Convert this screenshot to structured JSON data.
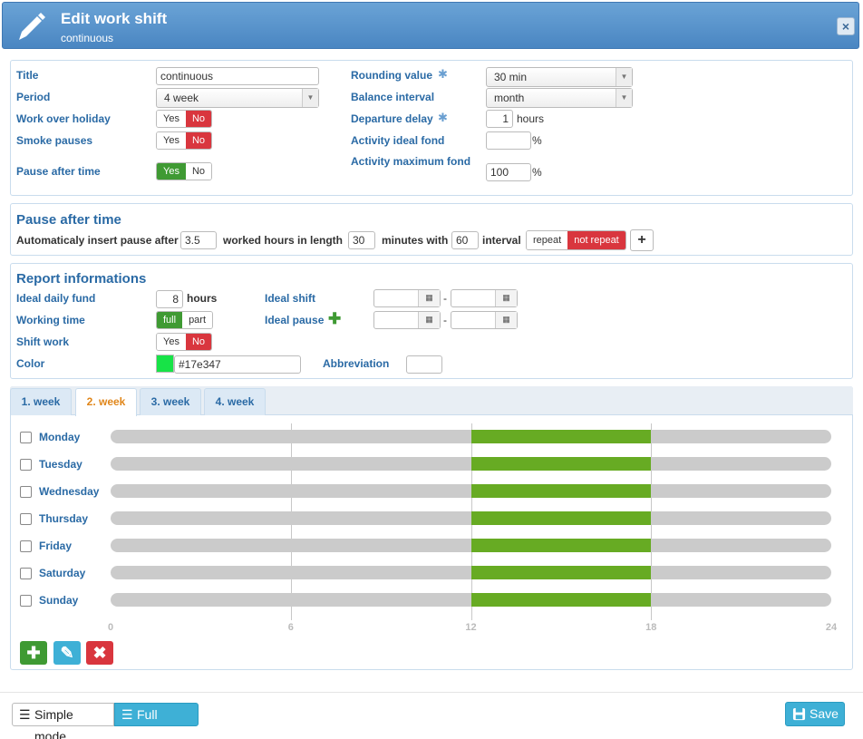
{
  "header": {
    "title": "Edit work shift",
    "subtitle": "continuous",
    "close_label": "×"
  },
  "general": {
    "title_label": "Title",
    "title_value": "continuous",
    "period_label": "Period",
    "period_value": "4 week",
    "work_over_holiday_label": "Work over holiday",
    "smoke_pauses_label": "Smoke pauses",
    "pause_after_time_label": "Pause after time",
    "yes": "Yes",
    "no": "No",
    "rounding_label": "Rounding value",
    "rounding_value": "30 min",
    "balance_label": "Balance interval",
    "balance_value": "month",
    "departure_label": "Departure delay",
    "departure_value": "1",
    "departure_unit": "hours",
    "ideal_fond_label": "Activity ideal fond",
    "ideal_fond_value": "",
    "percent": "%",
    "max_fond_label": "Activity maximum fond",
    "max_fond_value": "100"
  },
  "pause": {
    "section_title": "Pause after time",
    "text1": "Automaticaly insert pause after",
    "after_value": "3.5",
    "text2": "worked hours in length",
    "length_value": "30",
    "text3": "minutes with",
    "interval_value": "60",
    "text4": "interval",
    "repeat": "repeat",
    "not_repeat": "not repeat",
    "add": "+"
  },
  "report": {
    "section_title": "Report informations",
    "ideal_daily_label": "Ideal daily fund",
    "ideal_daily_value": "8",
    "hours": "hours",
    "working_time_label": "Working time",
    "full": "full",
    "part": "part",
    "shift_work_label": "Shift work",
    "yes": "Yes",
    "no": "No",
    "color_label": "Color",
    "color_value": "#17e347",
    "abbreviation_label": "Abbreviation",
    "abbreviation_value": "",
    "ideal_shift_label": "Ideal shift",
    "ideal_pause_label": "Ideal pause",
    "dash": "-"
  },
  "tabs": [
    {
      "label": "1. week"
    },
    {
      "label": "2. week"
    },
    {
      "label": "3. week"
    },
    {
      "label": "4. week"
    }
  ],
  "active_tab": 1,
  "days": [
    {
      "name": "Monday",
      "shift": [
        12,
        18
      ]
    },
    {
      "name": "Tuesday",
      "shift": [
        12,
        18
      ]
    },
    {
      "name": "Wednesday",
      "shift": [
        12,
        18
      ]
    },
    {
      "name": "Thursday",
      "shift": [
        12,
        18
      ]
    },
    {
      "name": "Friday",
      "shift": [
        12,
        18
      ]
    },
    {
      "name": "Saturday",
      "shift": [
        12,
        18
      ]
    },
    {
      "name": "Sunday",
      "shift": [
        12,
        18
      ]
    }
  ],
  "timeline": {
    "ticks": [
      "0",
      "6",
      "12",
      "18",
      "24"
    ],
    "range": [
      0,
      24
    ]
  },
  "colors": {
    "shift": "#67ab23",
    "accent": "#2a6aa5",
    "danger": "#d9363e",
    "success": "#3f9a33",
    "info": "#3eb0d6"
  },
  "footer": {
    "simple_mode": "Simple mode",
    "full_mode": "Full mode",
    "save": "Save"
  }
}
